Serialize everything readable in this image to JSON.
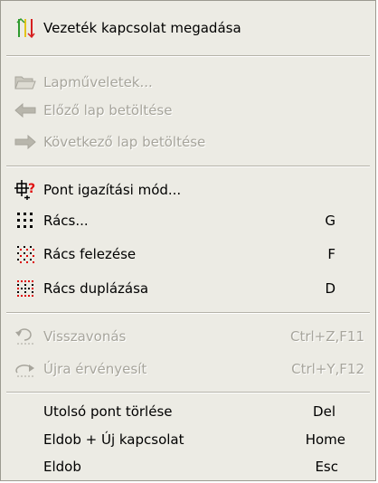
{
  "menu": {
    "items": [
      {
        "label": "Vezeték kapcsolat megadása",
        "shortcut": "",
        "icon": "wire-connection-icon",
        "enabled": true
      },
      {
        "label": "Lapműveletek...",
        "shortcut": "",
        "icon": "folder-open-icon",
        "enabled": false
      },
      {
        "label": "Előző lap betöltése",
        "shortcut": "",
        "icon": "arrow-left-icon",
        "enabled": false
      },
      {
        "label": "Következő lap betöltése",
        "shortcut": "",
        "icon": "arrow-right-icon",
        "enabled": false
      },
      {
        "label": "Pont igazítási mód...",
        "shortcut": "",
        "icon": "point-snap-mode-icon",
        "enabled": true
      },
      {
        "label": "Rács...",
        "shortcut": "G",
        "icon": "grid-icon",
        "enabled": true
      },
      {
        "label": "Rács felezése",
        "shortcut": "F",
        "icon": "grid-halve-icon",
        "enabled": true
      },
      {
        "label": "Rács duplázása",
        "shortcut": "D",
        "icon": "grid-double-icon",
        "enabled": true
      },
      {
        "label": "Visszavonás",
        "shortcut": "Ctrl+Z,F11",
        "icon": "undo-icon",
        "enabled": false
      },
      {
        "label": "Újra érvényesít",
        "shortcut": "Ctrl+Y,F12",
        "icon": "redo-icon",
        "enabled": false
      },
      {
        "label": "Utolsó pont törlése",
        "shortcut": "Del",
        "icon": "",
        "enabled": true
      },
      {
        "label": "Eldob + Új kapcsolat",
        "shortcut": "Home",
        "icon": "",
        "enabled": true
      },
      {
        "label": "Eldob",
        "shortcut": "Esc",
        "icon": "",
        "enabled": true
      }
    ]
  },
  "colors": {
    "menu_background": "#ecebe4",
    "disabled_text": "#a7a59c",
    "grid_dot_black": "#000000",
    "grid_dot_red": "#dd0000",
    "wire_icon_green": "#2e9a2e",
    "wire_icon_red": "#d61f1f",
    "wire_icon_yellow": "#e2c51a",
    "snap_icon_red": "#e01010"
  }
}
